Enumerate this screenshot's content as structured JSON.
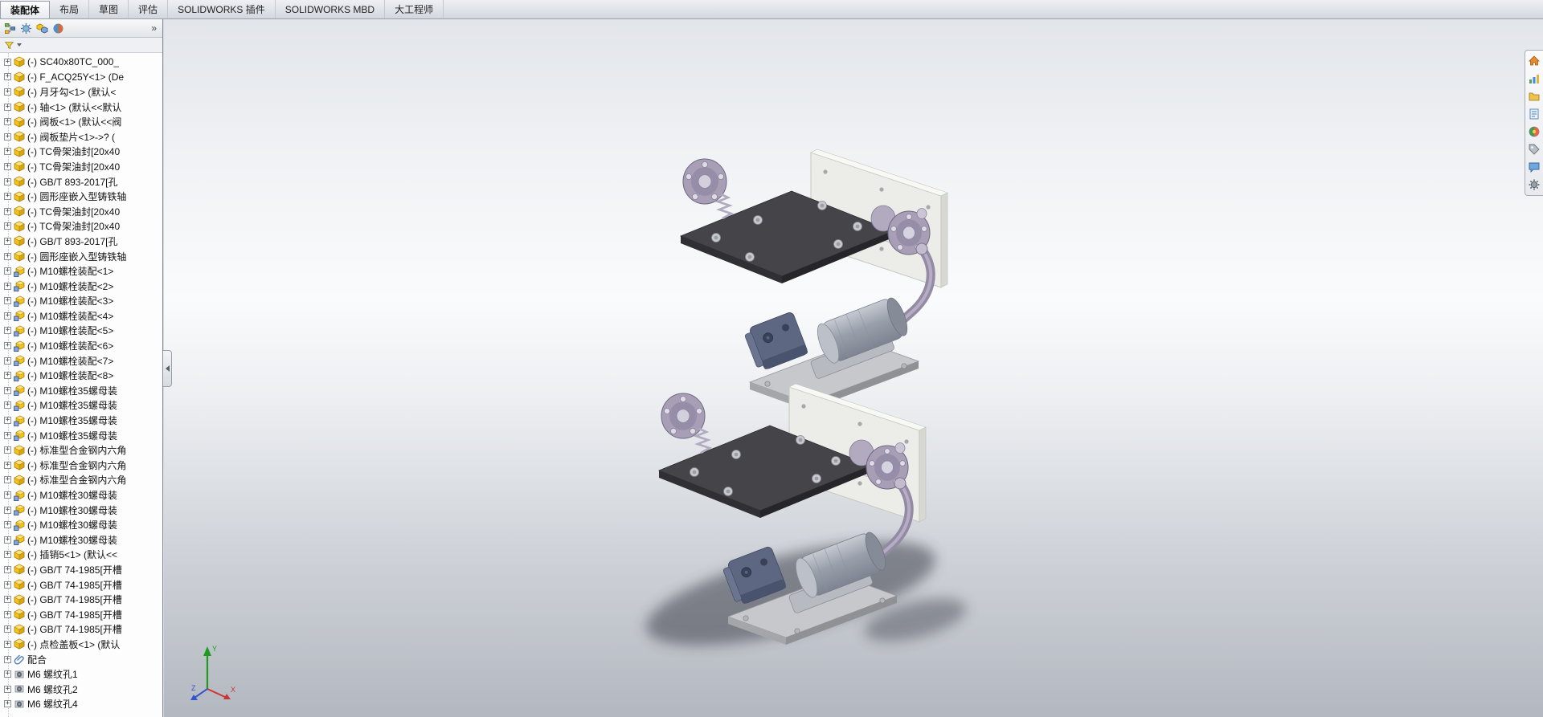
{
  "app": {
    "name": "SOLIDWORKS"
  },
  "command_bar": {
    "tabs": [
      {
        "label": "装配体",
        "active": true
      },
      {
        "label": "布局",
        "active": false
      },
      {
        "label": "草图",
        "active": false
      },
      {
        "label": "评估",
        "active": false
      },
      {
        "label": "SOLIDWORKS 插件",
        "active": false
      },
      {
        "label": "SOLIDWORKS MBD",
        "active": false
      },
      {
        "label": "大工程师",
        "active": false
      }
    ]
  },
  "view_toolbar": {
    "buttons": [
      {
        "name": "zoom-to-fit",
        "icon": "zoom-fit",
        "caret": false,
        "sep_after": false
      },
      {
        "name": "zoom-to-area",
        "icon": "zoom-area",
        "caret": false,
        "sep_after": false
      },
      {
        "name": "previous-view",
        "icon": "prev-view",
        "caret": false,
        "sep_after": true
      },
      {
        "name": "section-view",
        "icon": "section",
        "caret": true,
        "sep_after": true
      },
      {
        "name": "view-orientation",
        "icon": "orient",
        "caret": true,
        "sep_after": true
      },
      {
        "name": "display-style",
        "icon": "style",
        "caret": true,
        "sep_after": true
      },
      {
        "name": "hide-show-items",
        "icon": "hideshow",
        "caret": true,
        "sep_after": false
      },
      {
        "name": "edit-appearance",
        "icon": "appearance",
        "caret": false,
        "sep_after": false
      },
      {
        "name": "apply-scene",
        "icon": "scene",
        "caret": true,
        "sep_after": true
      },
      {
        "name": "view-settings",
        "icon": "viewset",
        "caret": true,
        "sep_after": false
      }
    ]
  },
  "window_controls": [
    {
      "name": "window-tile",
      "icon": "win-tile"
    },
    {
      "name": "window-minimize",
      "icon": "win-min"
    },
    {
      "name": "window-maximize",
      "icon": "win-max"
    },
    {
      "name": "window-close",
      "icon": "win-close"
    }
  ],
  "feature_panel": {
    "tabs": [
      {
        "name": "featuremanager-tab",
        "icon": "fm"
      },
      {
        "name": "propertymanager-tab",
        "icon": "pm"
      },
      {
        "name": "configurationmanager-tab",
        "icon": "cfg"
      },
      {
        "name": "displaymanager-tab",
        "icon": "disp"
      }
    ],
    "overflow_label": "»",
    "tree_items": [
      {
        "label": "(-) SC40x80TC_000_",
        "icon": "part"
      },
      {
        "label": "(-) F_ACQ25Y<1> (De",
        "icon": "part"
      },
      {
        "label": "(-) 月牙勾<1> (默认<",
        "icon": "part"
      },
      {
        "label": "(-) 轴<1> (默认<<默认",
        "icon": "part"
      },
      {
        "label": "(-) 阀板<1> (默认<<阀",
        "icon": "part"
      },
      {
        "label": "(-) 阀板垫片<1>->? (",
        "icon": "part"
      },
      {
        "label": "(-) TC骨架油封[20x40",
        "icon": "part"
      },
      {
        "label": "(-) TC骨架油封[20x40",
        "icon": "part"
      },
      {
        "label": "(-) GB/T 893-2017[孔",
        "icon": "part"
      },
      {
        "label": "(-) 圆形座嵌入型铸铁轴",
        "icon": "part"
      },
      {
        "label": "(-) TC骨架油封[20x40",
        "icon": "part"
      },
      {
        "label": "(-) TC骨架油封[20x40",
        "icon": "part"
      },
      {
        "label": "(-) GB/T 893-2017[孔",
        "icon": "part"
      },
      {
        "label": "(-) 圆形座嵌入型铸铁轴",
        "icon": "part"
      },
      {
        "label": "(-) M10螺栓装配<1>",
        "icon": "assembly"
      },
      {
        "label": "(-) M10螺栓装配<2>",
        "icon": "assembly"
      },
      {
        "label": "(-) M10螺栓装配<3>",
        "icon": "assembly"
      },
      {
        "label": "(-) M10螺栓装配<4>",
        "icon": "assembly"
      },
      {
        "label": "(-) M10螺栓装配<5>",
        "icon": "assembly"
      },
      {
        "label": "(-) M10螺栓装配<6>",
        "icon": "assembly"
      },
      {
        "label": "(-) M10螺栓装配<7>",
        "icon": "assembly"
      },
      {
        "label": "(-) M10螺栓装配<8>",
        "icon": "assembly"
      },
      {
        "label": "(-) M10螺栓35螺母装",
        "icon": "assembly"
      },
      {
        "label": "(-) M10螺栓35螺母装",
        "icon": "assembly"
      },
      {
        "label": "(-) M10螺栓35螺母装",
        "icon": "assembly"
      },
      {
        "label": "(-) M10螺栓35螺母装",
        "icon": "assembly"
      },
      {
        "label": "(-) 标准型合金钢内六角",
        "icon": "part"
      },
      {
        "label": "(-) 标准型合金钢内六角",
        "icon": "part"
      },
      {
        "label": "(-) 标准型合金钢内六角",
        "icon": "part"
      },
      {
        "label": "(-) M10螺栓30螺母装",
        "icon": "assembly"
      },
      {
        "label": "(-) M10螺栓30螺母装",
        "icon": "assembly"
      },
      {
        "label": "(-) M10螺栓30螺母装",
        "icon": "assembly"
      },
      {
        "label": "(-) M10螺栓30螺母装",
        "icon": "assembly"
      },
      {
        "label": "(-) 插销5<1> (默认<<",
        "icon": "part"
      },
      {
        "label": "(-) GB/T 74-1985[开槽",
        "icon": "part"
      },
      {
        "label": "(-) GB/T 74-1985[开槽",
        "icon": "part"
      },
      {
        "label": "(-) GB/T 74-1985[开槽",
        "icon": "part"
      },
      {
        "label": "(-) GB/T 74-1985[开槽",
        "icon": "part"
      },
      {
        "label": "(-) GB/T 74-1985[开槽",
        "icon": "part"
      },
      {
        "label": "(-) 点检盖板<1> (默认",
        "icon": "part"
      },
      {
        "label": "配合",
        "icon": "mates"
      },
      {
        "label": "M6 螺纹孔1",
        "icon": "hole"
      },
      {
        "label": "M6 螺纹孔2",
        "icon": "hole"
      },
      {
        "label": "M6 螺纹孔4",
        "icon": "hole"
      }
    ]
  },
  "task_pane": {
    "icons": [
      {
        "name": "solidworks-resources",
        "icon": "home"
      },
      {
        "name": "design-library",
        "icon": "chart"
      },
      {
        "name": "file-explorer",
        "icon": "folder"
      },
      {
        "name": "view-palette",
        "icon": "doc"
      },
      {
        "name": "appearances-scenes",
        "icon": "ball"
      },
      {
        "name": "custom-properties",
        "icon": "tag"
      },
      {
        "name": "solidworks-forum",
        "icon": "bubble"
      },
      {
        "name": "task-settings",
        "icon": "gear"
      }
    ]
  },
  "viewport": {
    "origin_triad": [
      {
        "axis": "Y",
        "color": "#1f9a1f"
      },
      {
        "axis": "X",
        "color": "#cc3333"
      },
      {
        "axis": "Z",
        "color": "#3355cc"
      }
    ],
    "background": {
      "top": "#e2e5ea",
      "middle": "#fafbfc",
      "bottom": "#b3b7bf"
    },
    "model_colors": {
      "dark_plate": "#454549",
      "light_plate": "#ecede8",
      "flange": "#a89fb6",
      "pump_block": "#5e6781",
      "motor": "#9aa0ab",
      "shadow": "#30353f"
    }
  }
}
